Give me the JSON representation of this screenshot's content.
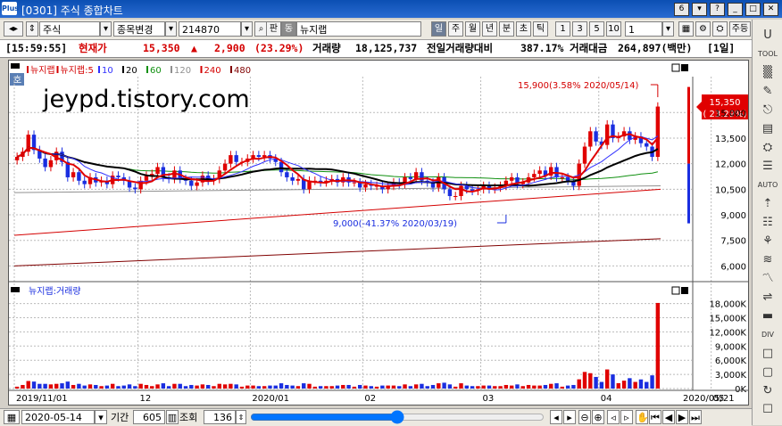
{
  "window": {
    "title": "[0301] 주식 종합차트",
    "logo_text": "Plus",
    "num_badge": "6"
  },
  "toolbar": {
    "market": "주식",
    "mode": "종목변경",
    "code": "214870",
    "pan_btn": "판",
    "stock_prefix": "동",
    "stock_name": "뉴지랩",
    "periods": [
      "일",
      "주",
      "월",
      "년",
      "분",
      "초",
      "틱"
    ],
    "period_selected": "일",
    "nums": [
      "1",
      "3",
      "5",
      "10"
    ],
    "interval_value": "1",
    "extra": "주등"
  },
  "info": {
    "time": "[15:59:55]",
    "price_label": "현재가",
    "price": "15,350",
    "change_arrow": "▲",
    "change": "2,900",
    "change_pct": "(23.29%)",
    "volume_label": "거래량",
    "volume": "18,125,737",
    "prev_vol_label": "전일거래량대비",
    "prev_vol": "387.17%",
    "amount_label": "거래대금",
    "amount": "264,897(백만)",
    "period": "[1일]"
  },
  "chart": {
    "watermark": "jeypd.tistory.com",
    "hoga_tag": "호",
    "legend": [
      {
        "text": "뉴지랩",
        "color": "#d40000"
      },
      {
        "text": "뉴지랩:5",
        "color": "#d40000"
      },
      {
        "text": "10",
        "color": "#3030ff"
      },
      {
        "text": "20",
        "color": "#000000"
      },
      {
        "text": "60",
        "color": "#109010"
      },
      {
        "text": "120",
        "color": "#909090"
      },
      {
        "text": "240",
        "color": "#d40000"
      },
      {
        "text": "480",
        "color": "#800000"
      }
    ],
    "high_annotation": "15,900(3.58% 2020/05/14)",
    "low_annotation": "9,000(-41.37% 2020/03/19)",
    "current_price_tag": "15,350",
    "current_pct_tag": "( 23.29%)",
    "volume_legend": "뉴지랩:거래량",
    "date_ticks": [
      "2019/11/01",
      "12",
      "2020/01",
      "02",
      "03",
      "04",
      "05"
    ],
    "last_date": "2020/05/21"
  },
  "chart_data": [
    {
      "type": "candlestick",
      "title": "",
      "ylim": [
        5500,
        17000
      ],
      "yticks": [
        "6,000",
        "7,500",
        "9,000",
        "10,500",
        "12,000",
        "13,500",
        "15,000"
      ],
      "ytick_values": [
        6000,
        7500,
        9000,
        10500,
        12000,
        13500,
        15000
      ],
      "candles_close": [
        12400,
        12700,
        13700,
        12800,
        12300,
        11800,
        12200,
        12700,
        12100,
        11200,
        11500,
        11000,
        10800,
        11200,
        10900,
        11000,
        10800,
        11300,
        11200,
        11000,
        10600,
        10500,
        11000,
        11300,
        11400,
        11800,
        11200,
        11100,
        11600,
        11100,
        11000,
        10700,
        10900,
        11300,
        11000,
        11100,
        11600,
        12000,
        12500,
        12100,
        12100,
        12300,
        12500,
        12400,
        12500,
        12300,
        12100,
        11500,
        11200,
        11000,
        11100,
        10500,
        11000,
        11000,
        10900,
        11000,
        11100,
        10900,
        11200,
        10900,
        10900,
        10600,
        10800,
        10700,
        10700,
        10500,
        10700,
        10900,
        10800,
        11200,
        11100,
        11500,
        11000,
        10900,
        10600,
        11200,
        10500,
        10100,
        10100,
        10700,
        10500,
        10400,
        10500,
        10700,
        10500,
        10600,
        10700,
        11000,
        11200,
        10800,
        10900,
        11200,
        11400,
        11600,
        11300,
        11800,
        11200,
        11200,
        11000,
        10700,
        12000,
        13000,
        13900,
        13300,
        13100,
        14300,
        13500,
        13600,
        13900,
        13400,
        13600,
        13200,
        13000,
        12400,
        15350
      ],
      "volume_series": {
        "name": "뉴지랩:거래량",
        "unit": "K",
        "ylim": [
          0,
          20000
        ],
        "yticks": [
          "0K",
          "3,000K",
          "6,000K",
          "9,000K",
          "12,000K",
          "15,000K",
          "18,000K"
        ],
        "ytick_values": [
          0,
          3000,
          6000,
          9000,
          12000,
          15000,
          18000
        ],
        "last_value": 18126
      }
    }
  ],
  "bottom": {
    "date": "2020-05-14",
    "period_label": "기간",
    "period_value": "605",
    "view_label": "조회",
    "view_value": "136"
  },
  "sidebar": {
    "icons": [
      "U",
      "TOOL",
      "▒",
      "✎",
      "⎋",
      "▤",
      "⛭",
      "☰",
      "AUTO",
      "⇡",
      "☷",
      "⚘",
      "≋",
      "〽",
      "⇌",
      "▬",
      "DIV",
      "□",
      "▢",
      "↻",
      "☐"
    ]
  },
  "colors": {
    "up": "#e00000",
    "down": "#1a2ee0",
    "title_bg": "#0b4fb3",
    "ma20": "#000000",
    "ma5": "#d40000"
  }
}
